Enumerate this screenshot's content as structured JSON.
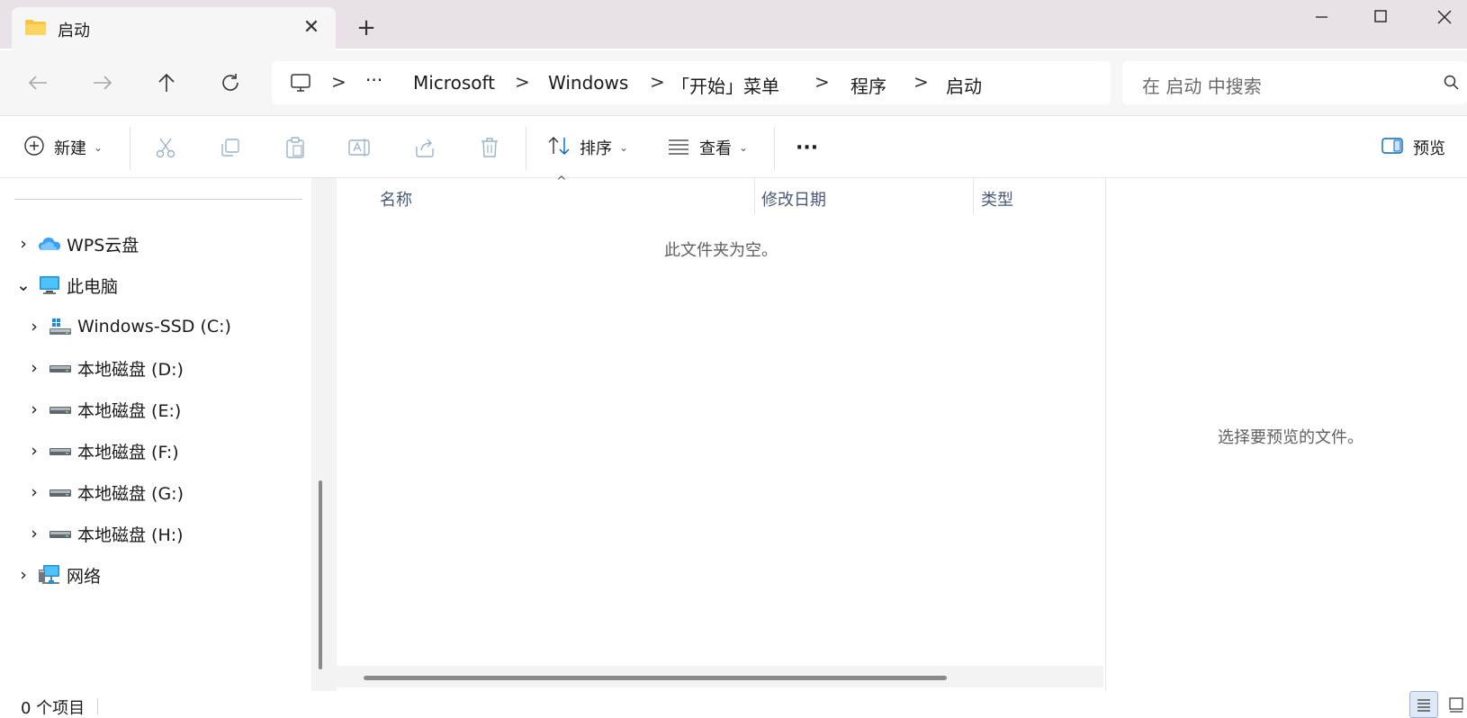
{
  "window": {
    "tab_title": "启动",
    "tab_close": "✕",
    "new_tab": "+"
  },
  "nav": {
    "breadcrumbs": [
      "Microsoft",
      "Windows",
      "「开始」菜单",
      "程序",
      "启动"
    ],
    "more": "···",
    "separator": ">",
    "search_placeholder": "在 启动 中搜索"
  },
  "toolbar": {
    "new_label": "新建",
    "sort_label": "排序",
    "view_label": "查看",
    "more": "···",
    "preview_label": "预览",
    "chevron": "⌄"
  },
  "sidebar": {
    "items": [
      {
        "label": "WPS云盘",
        "expander": "›",
        "icon": "cloud-icon"
      },
      {
        "label": "此电脑",
        "expander": "⌄",
        "icon": "computer-icon"
      },
      {
        "label": "Windows-SSD (C:)",
        "expander": "›",
        "icon": "windows-drive-icon"
      },
      {
        "label": "本地磁盘 (D:)",
        "expander": "›",
        "icon": "drive-icon"
      },
      {
        "label": "本地磁盘 (E:)",
        "expander": "›",
        "icon": "drive-icon"
      },
      {
        "label": "本地磁盘 (F:)",
        "expander": "›",
        "icon": "drive-icon"
      },
      {
        "label": "本地磁盘 (G:)",
        "expander": "›",
        "icon": "drive-icon"
      },
      {
        "label": "本地磁盘 (H:)",
        "expander": "›",
        "icon": "drive-icon"
      },
      {
        "label": "网络",
        "expander": "›",
        "icon": "network-icon"
      }
    ]
  },
  "content": {
    "columns": [
      "名称",
      "修改日期",
      "类型"
    ],
    "sort_indicator": "^",
    "empty_message": "此文件夹为空。"
  },
  "preview": {
    "message": "选择要预览的文件。"
  },
  "status": {
    "item_count": "0 个项目"
  },
  "colors": {
    "titlebar": "#e8e2e6",
    "navbar": "#f7f6f7",
    "accent": "#0067c0",
    "folder": "#f5c542"
  }
}
